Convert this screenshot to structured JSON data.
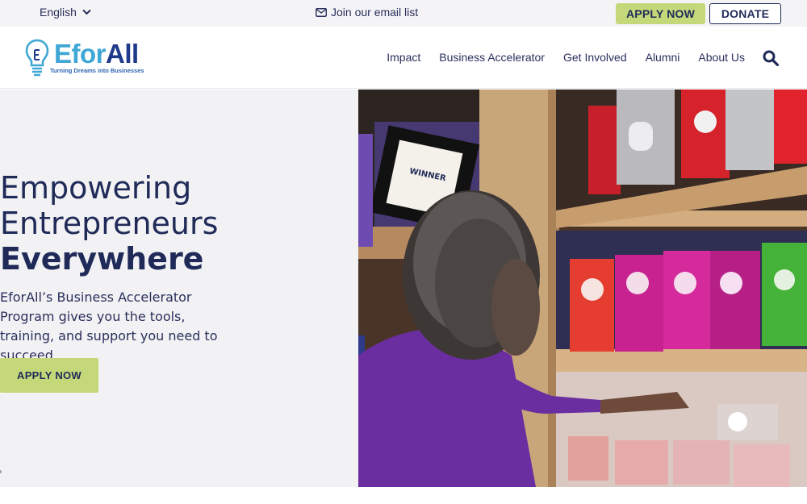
{
  "topbar": {
    "language": "English",
    "email_link": "Join our email list",
    "apply_label": "APPLY NOW",
    "donate_label": "DONATE"
  },
  "logo": {
    "name_part1": "Efor",
    "name_part2": "All",
    "tagline": "Turning Dreams into Businesses"
  },
  "nav": {
    "items": [
      "Impact",
      "Business Accelerator",
      "Get Involved",
      "Alumni",
      "About Us"
    ]
  },
  "hero": {
    "line1": "Empowering",
    "line2": "Entrepreneurs",
    "line3": "Everywhere",
    "subtitle": "EforAll’s Business Accelerator Program gives you the tools, training, and support you need to succeed.",
    "apply_label": "APPLY NOW"
  },
  "photo": {
    "sign_text": "WINNER"
  },
  "icons": {
    "chevron": "chevron-down-icon",
    "mail": "mail-icon",
    "search": "search-icon",
    "bulb": "lightbulb-icon"
  },
  "colors": {
    "accent_green": "#c4d87a",
    "navy": "#1f2a58",
    "logo_blue": "#3fa7d6",
    "hero_bg": "#f2f2f4"
  }
}
